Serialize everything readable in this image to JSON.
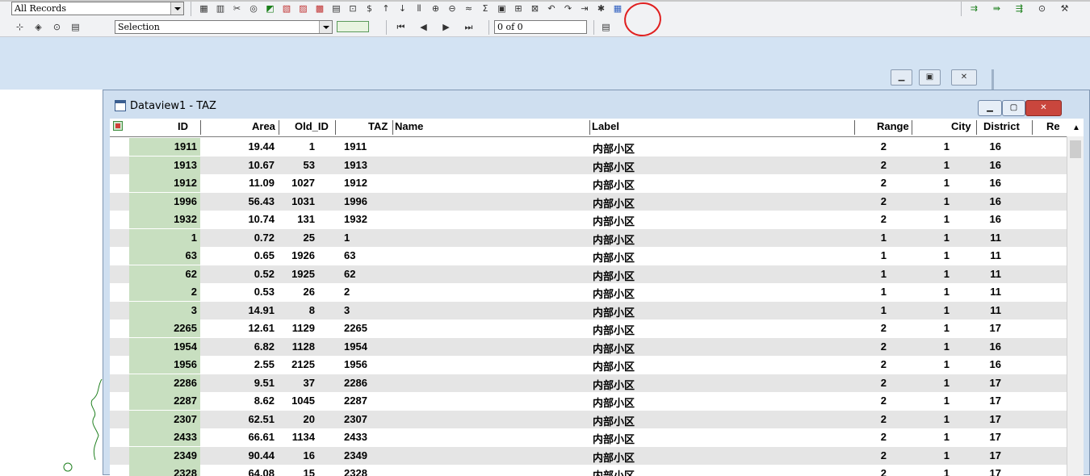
{
  "toolbar1": {
    "record_filter": "All Records",
    "icons": [
      "table-icon",
      "chart-icon",
      "scissors-icon",
      "binoculars-icon",
      "fill-color-icon",
      "hatch-icon",
      "pattern-icon",
      "pattern2-icon",
      "calculator-icon",
      "lock-icon",
      "currency-icon",
      "sort-ascending-icon",
      "sort-descending-icon",
      "columns-icon",
      "join-icon",
      "split-icon",
      "xy-icon",
      "formula-icon",
      "field-properties-icon",
      "add-field-icon",
      "delete-field-icon",
      "undo-icon",
      "redo-icon",
      "export-icon",
      "pin-icon",
      "palette-icon"
    ],
    "right_icons": [
      "network-icon",
      "path-icon",
      "route-icon",
      "zoom-icon",
      "tools-icon"
    ]
  },
  "toolbar2": {
    "selection_set": "Selection",
    "record_position": "0 of 0",
    "nav": [
      "first-record-icon",
      "previous-record-icon",
      "next-record-icon",
      "last-record-icon"
    ]
  },
  "dataview": {
    "title": "Dataview1 - TAZ",
    "columns": [
      "ID",
      "Area",
      "Old_ID",
      "TAZ",
      "Name",
      "Label",
      "Range",
      "City",
      "District",
      "Re"
    ],
    "rows": [
      {
        "id": "1911",
        "area": "19.44",
        "old_id": "1",
        "taz": "1911",
        "name": "",
        "label": "内部小区",
        "range": "2",
        "city": "1",
        "district": "16"
      },
      {
        "id": "1913",
        "area": "10.67",
        "old_id": "53",
        "taz": "1913",
        "name": "",
        "label": "内部小区",
        "range": "2",
        "city": "1",
        "district": "16"
      },
      {
        "id": "1912",
        "area": "11.09",
        "old_id": "1027",
        "taz": "1912",
        "name": "",
        "label": "内部小区",
        "range": "2",
        "city": "1",
        "district": "16"
      },
      {
        "id": "1996",
        "area": "56.43",
        "old_id": "1031",
        "taz": "1996",
        "name": "",
        "label": "内部小区",
        "range": "2",
        "city": "1",
        "district": "16"
      },
      {
        "id": "1932",
        "area": "10.74",
        "old_id": "131",
        "taz": "1932",
        "name": "",
        "label": "内部小区",
        "range": "2",
        "city": "1",
        "district": "16"
      },
      {
        "id": "1",
        "area": "0.72",
        "old_id": "25",
        "taz": "1",
        "name": "",
        "label": "内部小区",
        "range": "1",
        "city": "1",
        "district": "11"
      },
      {
        "id": "63",
        "area": "0.65",
        "old_id": "1926",
        "taz": "63",
        "name": "",
        "label": "内部小区",
        "range": "1",
        "city": "1",
        "district": "11"
      },
      {
        "id": "62",
        "area": "0.52",
        "old_id": "1925",
        "taz": "62",
        "name": "",
        "label": "内部小区",
        "range": "1",
        "city": "1",
        "district": "11"
      },
      {
        "id": "2",
        "area": "0.53",
        "old_id": "26",
        "taz": "2",
        "name": "",
        "label": "内部小区",
        "range": "1",
        "city": "1",
        "district": "11"
      },
      {
        "id": "3",
        "area": "14.91",
        "old_id": "8",
        "taz": "3",
        "name": "",
        "label": "内部小区",
        "range": "1",
        "city": "1",
        "district": "11"
      },
      {
        "id": "2265",
        "area": "12.61",
        "old_id": "1129",
        "taz": "2265",
        "name": "",
        "label": "内部小区",
        "range": "2",
        "city": "1",
        "district": "17"
      },
      {
        "id": "1954",
        "area": "6.82",
        "old_id": "1128",
        "taz": "1954",
        "name": "",
        "label": "内部小区",
        "range": "2",
        "city": "1",
        "district": "16"
      },
      {
        "id": "1956",
        "area": "2.55",
        "old_id": "2125",
        "taz": "1956",
        "name": "",
        "label": "内部小区",
        "range": "2",
        "city": "1",
        "district": "16"
      },
      {
        "id": "2286",
        "area": "9.51",
        "old_id": "37",
        "taz": "2286",
        "name": "",
        "label": "内部小区",
        "range": "2",
        "city": "1",
        "district": "17"
      },
      {
        "id": "2287",
        "area": "8.62",
        "old_id": "1045",
        "taz": "2287",
        "name": "",
        "label": "内部小区",
        "range": "2",
        "city": "1",
        "district": "17"
      },
      {
        "id": "2307",
        "area": "62.51",
        "old_id": "20",
        "taz": "2307",
        "name": "",
        "label": "内部小区",
        "range": "2",
        "city": "1",
        "district": "17"
      },
      {
        "id": "2433",
        "area": "66.61",
        "old_id": "1134",
        "taz": "2433",
        "name": "",
        "label": "内部小区",
        "range": "2",
        "city": "1",
        "district": "17"
      },
      {
        "id": "2349",
        "area": "90.44",
        "old_id": "16",
        "taz": "2349",
        "name": "",
        "label": "内部小区",
        "range": "2",
        "city": "1",
        "district": "17"
      },
      {
        "id": "2328",
        "area": "64.08",
        "old_id": "15",
        "taz": "2328",
        "name": "",
        "label": "内部小区",
        "range": "2",
        "city": "1",
        "district": "17"
      }
    ]
  },
  "colors": {
    "id_column_bg": "#c8dfc0",
    "alt_row_bg": "#e5e5e5",
    "mdi_bg": "#d3e3f3",
    "close_button": "#c9463d",
    "annotation_circle": "#e02020"
  }
}
